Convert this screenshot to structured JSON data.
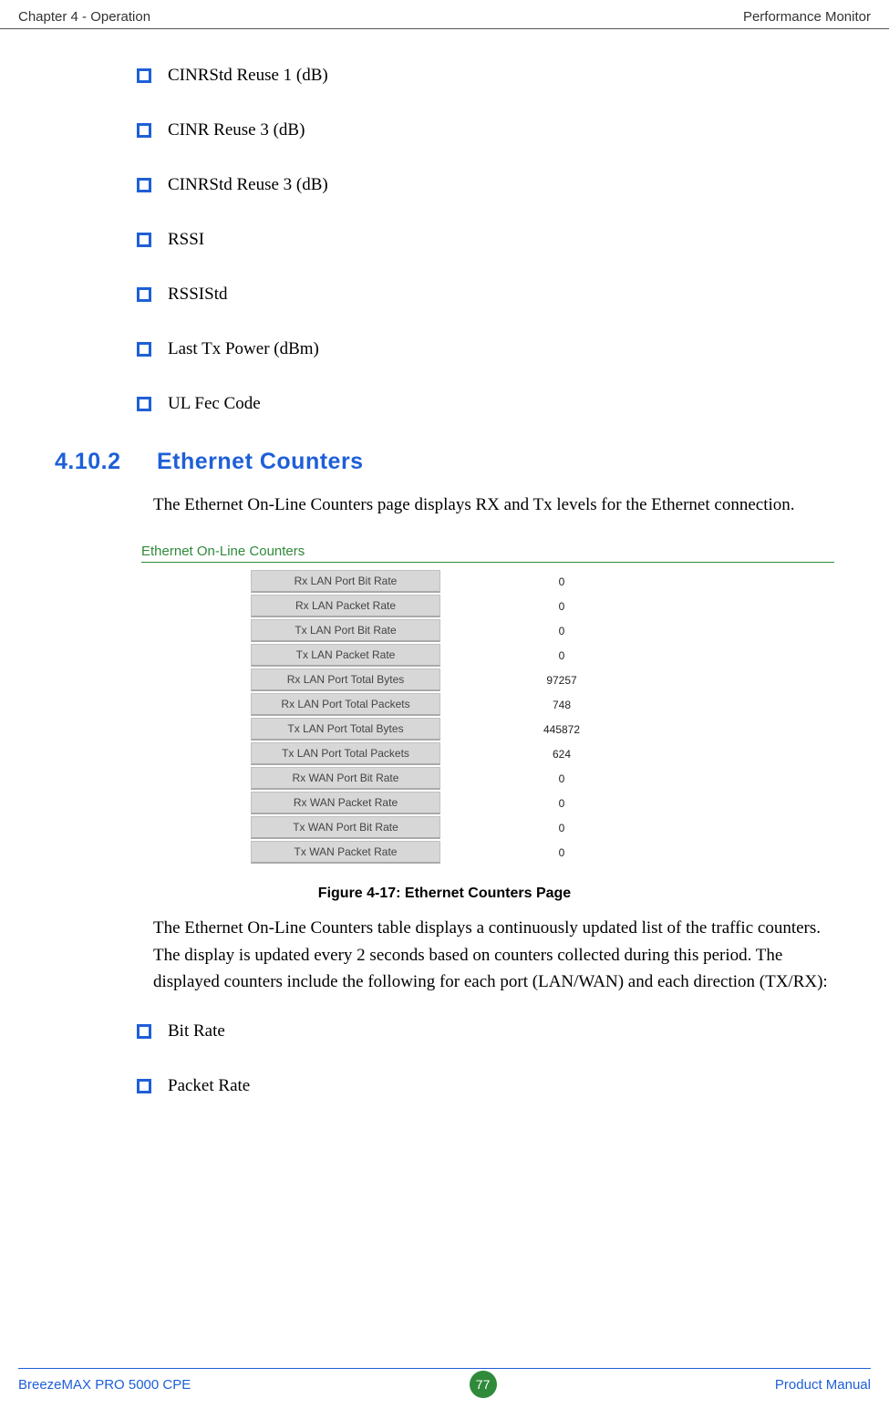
{
  "header": {
    "left": "Chapter 4 - Operation",
    "right": "Performance Monitor"
  },
  "top_bullets": [
    "CINRStd Reuse 1 (dB)",
    "CINR Reuse 3 (dB)",
    "CINRStd Reuse 3 (dB)",
    "RSSI",
    "RSSIStd",
    "Last Tx Power (dBm)",
    "UL Fec Code"
  ],
  "section": {
    "number": "4.10.2",
    "title": "Ethernet Counters",
    "intro": "The Ethernet On-Line Counters page displays RX and Tx levels for the Ethernet connection."
  },
  "figure": {
    "panel_title": "Ethernet On-Line Counters",
    "rows": [
      {
        "label": "Rx LAN Port Bit Rate",
        "value": "0"
      },
      {
        "label": "Rx LAN Packet Rate",
        "value": "0"
      },
      {
        "label": "Tx LAN Port Bit Rate",
        "value": "0"
      },
      {
        "label": "Tx LAN Packet Rate",
        "value": "0"
      },
      {
        "label": "Rx LAN Port Total Bytes",
        "value": "97257"
      },
      {
        "label": "Rx LAN Port Total Packets",
        "value": "748"
      },
      {
        "label": "Tx LAN Port Total Bytes",
        "value": "445872"
      },
      {
        "label": "Tx LAN Port Total Packets",
        "value": "624"
      },
      {
        "label": "Rx WAN Port Bit Rate",
        "value": "0"
      },
      {
        "label": "Rx WAN Packet Rate",
        "value": "0"
      },
      {
        "label": "Tx WAN Port Bit Rate",
        "value": "0"
      },
      {
        "label": "Tx WAN Packet Rate",
        "value": "0"
      }
    ],
    "caption": "Figure 4-17: Ethernet Counters Page"
  },
  "after_figure": "The Ethernet On-Line Counters table displays a continuously updated list of the traffic counters. The display is updated every 2 seconds based on counters collected during this period. The displayed counters include the following for each port (LAN/WAN) and each direction (TX/RX):",
  "bottom_bullets": [
    "Bit Rate",
    "Packet Rate"
  ],
  "footer": {
    "left": "BreezeMAX PRO 5000 CPE",
    "page": "77",
    "right": "Product Manual"
  }
}
